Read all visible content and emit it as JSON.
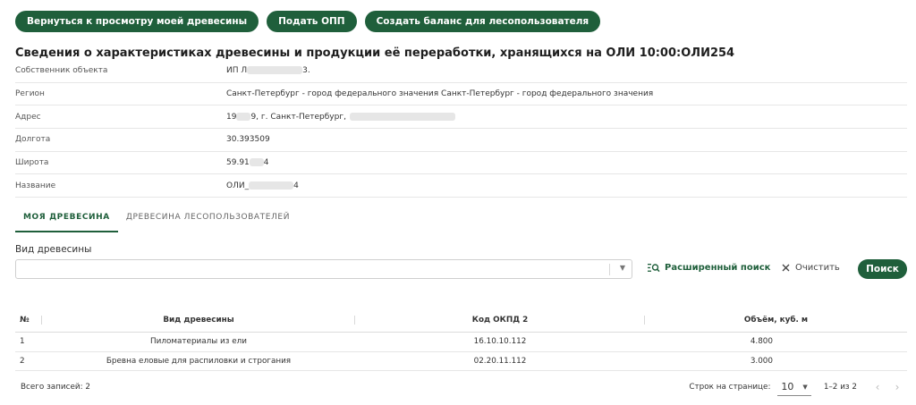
{
  "toolbar": {
    "back_label": "Вернуться к просмотру моей древесины",
    "submit_label": "Подать ОПП",
    "create_balance_label": "Создать баланс для лесопользователя"
  },
  "page": {
    "title": "Сведения о характеристиках древесины и продукции её переработки, хранящихся на ОЛИ 10:00:ОЛИ254"
  },
  "info": {
    "owner": {
      "label": "Собственник объекта",
      "value_pre": "ИП Л",
      "value_post": "3."
    },
    "region": {
      "label": "Регион",
      "value": "Санкт-Петербург - город федерального значения Санкт-Петербург - город федерального значения"
    },
    "address": {
      "label": "Адрес",
      "value_pre": "19",
      "value_post": "9, г. Санкт-Петербург,"
    },
    "longitude": {
      "label": "Долгота",
      "value": "30.393509"
    },
    "latitude": {
      "label": "Широта",
      "value_pre": "59.91",
      "value_post": "4"
    },
    "name": {
      "label": "Название",
      "value_pre": "ОЛИ_",
      "value_post": "4"
    }
  },
  "tabs": [
    {
      "label": "МОЯ ДРЕВЕСИНА",
      "active": true
    },
    {
      "label": "ДРЕВЕСИНА ЛЕСОПОЛЬЗОВАТЕЛЕЙ",
      "active": false
    }
  ],
  "filter": {
    "label": "Вид древесины",
    "value": "",
    "advanced_search_label": "Расширенный поиск",
    "clear_label": "Очистить",
    "search_label": "Поиск"
  },
  "table": {
    "columns": [
      "№",
      "Вид древесины",
      "Код ОКПД 2",
      "Объём, куб. м"
    ],
    "rows": [
      [
        "1",
        "Пиломатериалы из ели",
        "16.10.10.112",
        "4.800"
      ],
      [
        "2",
        "Бревна еловые для распиловки и строгания",
        "02.20.11.112",
        "3.000"
      ]
    ]
  },
  "footer": {
    "total": "Всего записей: 2",
    "rows_per_page_label": "Строк на странице:",
    "rows_per_page_value": "10",
    "range": "1–2 из 2"
  },
  "colors": {
    "accent": "#1f5f3b"
  }
}
